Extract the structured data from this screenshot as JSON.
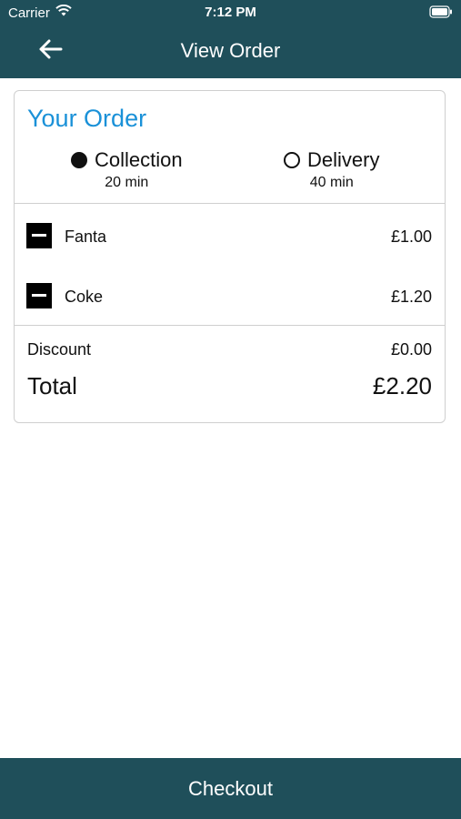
{
  "status_bar": {
    "carrier": "Carrier",
    "time": "7:12 PM",
    "wifi_icon": "wifi-icon",
    "battery_icon": "battery-icon"
  },
  "header": {
    "back_icon": "arrow-left-icon",
    "title": "View Order",
    "background": "#1f4f5a"
  },
  "order": {
    "title": "Your Order",
    "title_color": "#1a91d8",
    "options": [
      {
        "label": "Collection",
        "time": "20 min",
        "selected": true
      },
      {
        "label": "Delivery",
        "time": "40 min",
        "selected": false
      }
    ],
    "items": [
      {
        "name": "Fanta",
        "price": "£1.00",
        "remove_icon": "minus-square-icon"
      },
      {
        "name": "Coke",
        "price": "£1.20",
        "remove_icon": "minus-square-icon"
      }
    ],
    "discount_label": "Discount",
    "discount_value": "£0.00",
    "total_label": "Total",
    "total_value": "£2.20"
  },
  "footer": {
    "checkout_label": "Checkout",
    "background": "#1f4f5a"
  }
}
